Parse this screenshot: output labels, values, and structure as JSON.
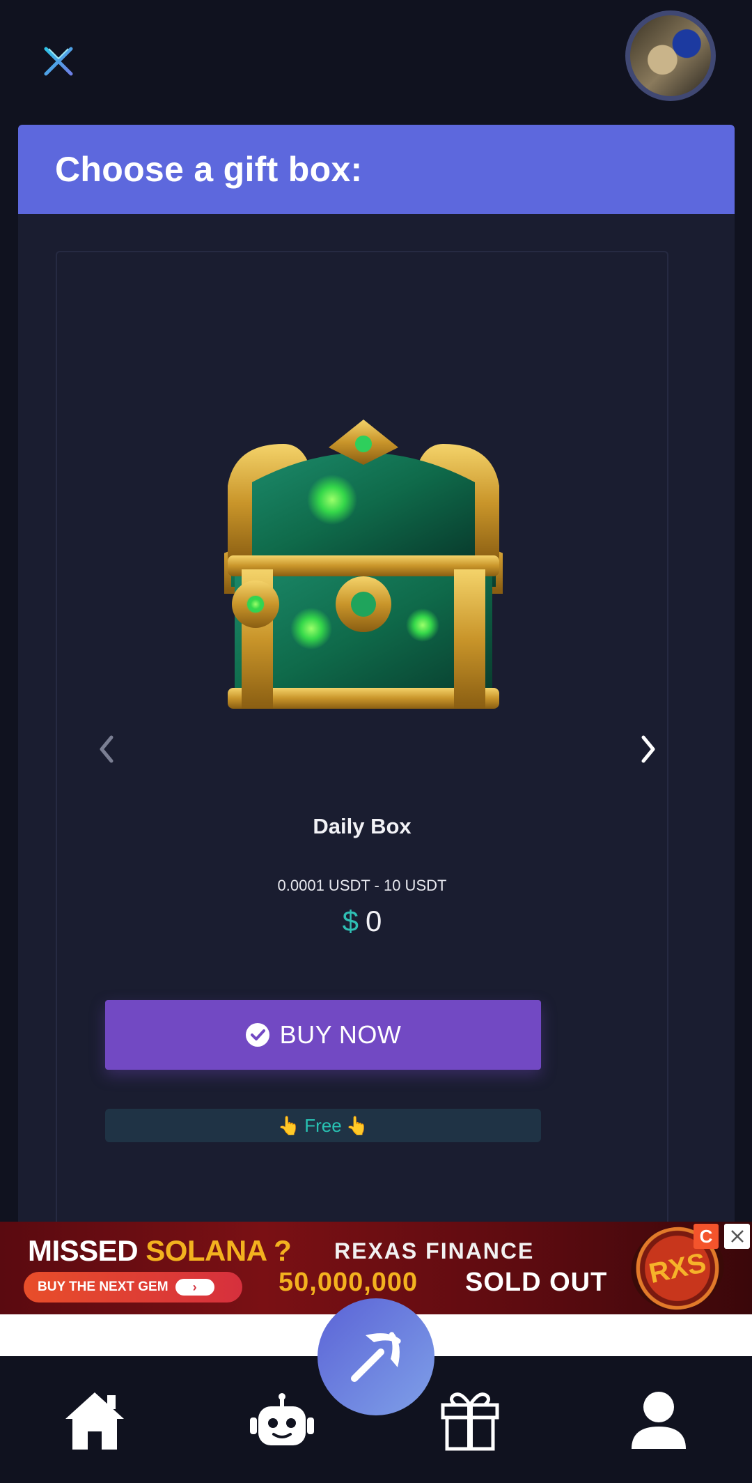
{
  "header": {
    "logo_icon": "x-logo-icon",
    "avatar_alt": "user avatar"
  },
  "card": {
    "title": "Choose a gift box:"
  },
  "gift_box": {
    "name": "Daily Box",
    "range": "0.0001 USDT - 10 USDT",
    "currency_symbol": "$",
    "price": "0",
    "buy_label": "BUY NOW",
    "free_label": "Free",
    "free_emoji_left": "👆",
    "free_emoji_right": "👆"
  },
  "ad": {
    "headline_white": "MISSED ",
    "headline_gold": "SOLANA ?",
    "cta": "BUY THE NEXT GEM",
    "brand": "REXAS FINANCE",
    "count": "50,000,000",
    "sold": "SOLD OUT",
    "coin_text": "RXS",
    "choices_badge": "C"
  },
  "nav": {
    "items": [
      {
        "icon": "home-icon"
      },
      {
        "icon": "robot-icon"
      },
      {
        "icon": "gift-icon"
      },
      {
        "icon": "profile-icon"
      }
    ],
    "fab_icon": "pickaxe-icon"
  },
  "colors": {
    "background": "#10121f",
    "card": "#1a1d30",
    "header_accent": "#5d68dd",
    "buy_button": "#7249c3",
    "free_text": "#28c2b3",
    "currency": "#2fbfb4"
  }
}
